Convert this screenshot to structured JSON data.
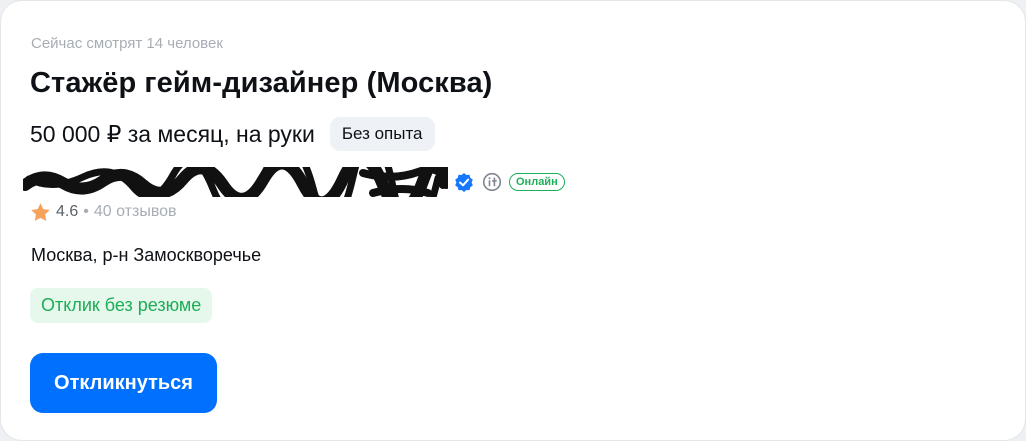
{
  "vacancy": {
    "viewers_text": "Сейчас смотрят 14 человек",
    "title": "Стажёр гейм-дизайнер (Москва)",
    "salary": "50 000 ₽ за месяц, на руки",
    "experience_badge": "Без опыта",
    "location": "Москва, р-н Замоскворечье",
    "no_resume_badge": "Отклик без резюме",
    "apply_button_label": "Откликнуться"
  },
  "company": {
    "online_badge": "Онлайн",
    "rating": "4.6",
    "separator": "•",
    "reviews": "40 отзывов",
    "verified_icon": "verified-check-icon",
    "accredit_icon": "accredited-it-icon"
  },
  "colors": {
    "primary": "#0070ff",
    "success": "#1cb05c",
    "success_bg": "#e6f8ec",
    "star": "#f5a25d",
    "muted": "#a7adb5"
  }
}
